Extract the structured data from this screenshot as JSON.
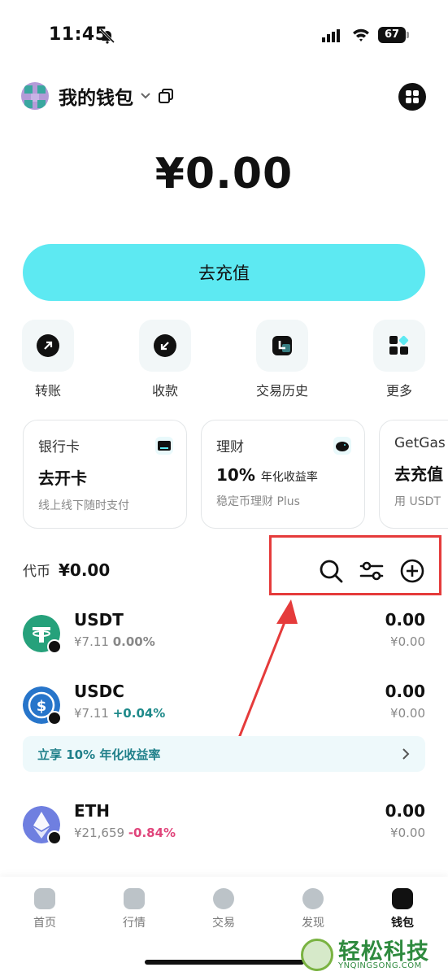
{
  "status_bar": {
    "time": "11:45",
    "battery": "67"
  },
  "header": {
    "wallet_name": "我的钱包"
  },
  "balance": "¥0.00",
  "topup_button": "去充值",
  "actions": [
    {
      "label": "转账",
      "icon": "send-icon"
    },
    {
      "label": "收款",
      "icon": "receive-icon"
    },
    {
      "label": "交易历史",
      "icon": "history-icon"
    },
    {
      "label": "更多",
      "icon": "more-apps-icon"
    }
  ],
  "cards": [
    {
      "title": "银行卡",
      "headline": "去开卡",
      "headline_suffix": "",
      "sub": "线上线下随时支付",
      "icon": "card-icon"
    },
    {
      "title": "理财",
      "headline": "10%",
      "headline_suffix": "年化收益率",
      "sub": "稳定币理财 Plus",
      "icon": "piggy-bank-icon"
    },
    {
      "title": "GetGas",
      "headline": "去充值",
      "headline_suffix": "",
      "sub": "用 USDT",
      "icon": ""
    }
  ],
  "tokens_section": {
    "label": "代币",
    "total": "¥0.00"
  },
  "tokens": [
    {
      "symbol": "USDT",
      "price": "¥7.11",
      "change": "0.00%",
      "change_color": "#888888",
      "amount": "0.00",
      "fiat": "¥0.00",
      "logo_color": "#26a17b"
    },
    {
      "symbol": "USDC",
      "price": "¥7.11",
      "change": "+0.04%",
      "change_color": "#1f8a8a",
      "amount": "0.00",
      "fiat": "¥0.00",
      "logo_color": "#2775ca"
    },
    {
      "symbol": "ETH",
      "price": "¥21,659",
      "change": "-0.84%",
      "change_color": "#e0457b",
      "amount": "0.00",
      "fiat": "¥0.00",
      "logo_color": "#6f7fe0"
    }
  ],
  "promo": {
    "text": "立享 10% 年化收益率"
  },
  "bottom_nav": [
    {
      "label": "首页",
      "active": false
    },
    {
      "label": "行情",
      "active": false
    },
    {
      "label": "交易",
      "active": false
    },
    {
      "label": "发现",
      "active": false
    },
    {
      "label": "钱包",
      "active": true
    }
  ],
  "watermark": {
    "title": "轻松科技",
    "url": "YNQINGSONG.COM"
  },
  "colors": {
    "accent": "#5de9f2",
    "highlight": "#e53b3b"
  }
}
